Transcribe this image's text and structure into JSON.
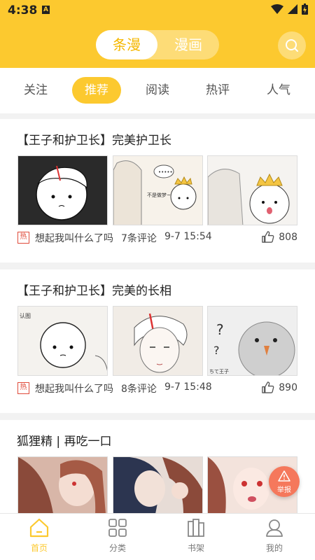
{
  "status": {
    "time": "4:38",
    "notif_letter": "A"
  },
  "header": {
    "seg_active": "条漫",
    "seg_inactive": "漫画"
  },
  "tabs": [
    "关注",
    "推荐",
    "阅读",
    "热评",
    "人气"
  ],
  "posts": [
    {
      "title": "【王子和护卫长】完美护卫长",
      "hot": "热",
      "author": "想起我叫什么了吗",
      "comments": "7条评论",
      "time": "9-7 15:54",
      "likes": "808",
      "panel_texts": [
        "",
        "不是做梦~",
        ""
      ]
    },
    {
      "title": "【王子和护卫长】完美的长相",
      "hot": "热",
      "author": "想起我叫什么了吗",
      "comments": "8条评论",
      "time": "9-7 15:48",
      "likes": "890",
      "panel_texts": [
        "认图",
        "",
        "ちて王子"
      ]
    },
    {
      "title": "狐狸精 | 再吃一口"
    }
  ],
  "fab": {
    "label": "举报"
  },
  "bottom_nav": [
    {
      "label": "首页",
      "icon": "home-icon"
    },
    {
      "label": "分类",
      "icon": "grid-icon"
    },
    {
      "label": "书架",
      "icon": "bookshelf-icon"
    },
    {
      "label": "我的",
      "icon": "user-icon"
    }
  ],
  "colors": {
    "accent": "#fcc92f",
    "active_text": "#f5b700",
    "hot": "#e04a3a",
    "fab": "#f5785c"
  }
}
